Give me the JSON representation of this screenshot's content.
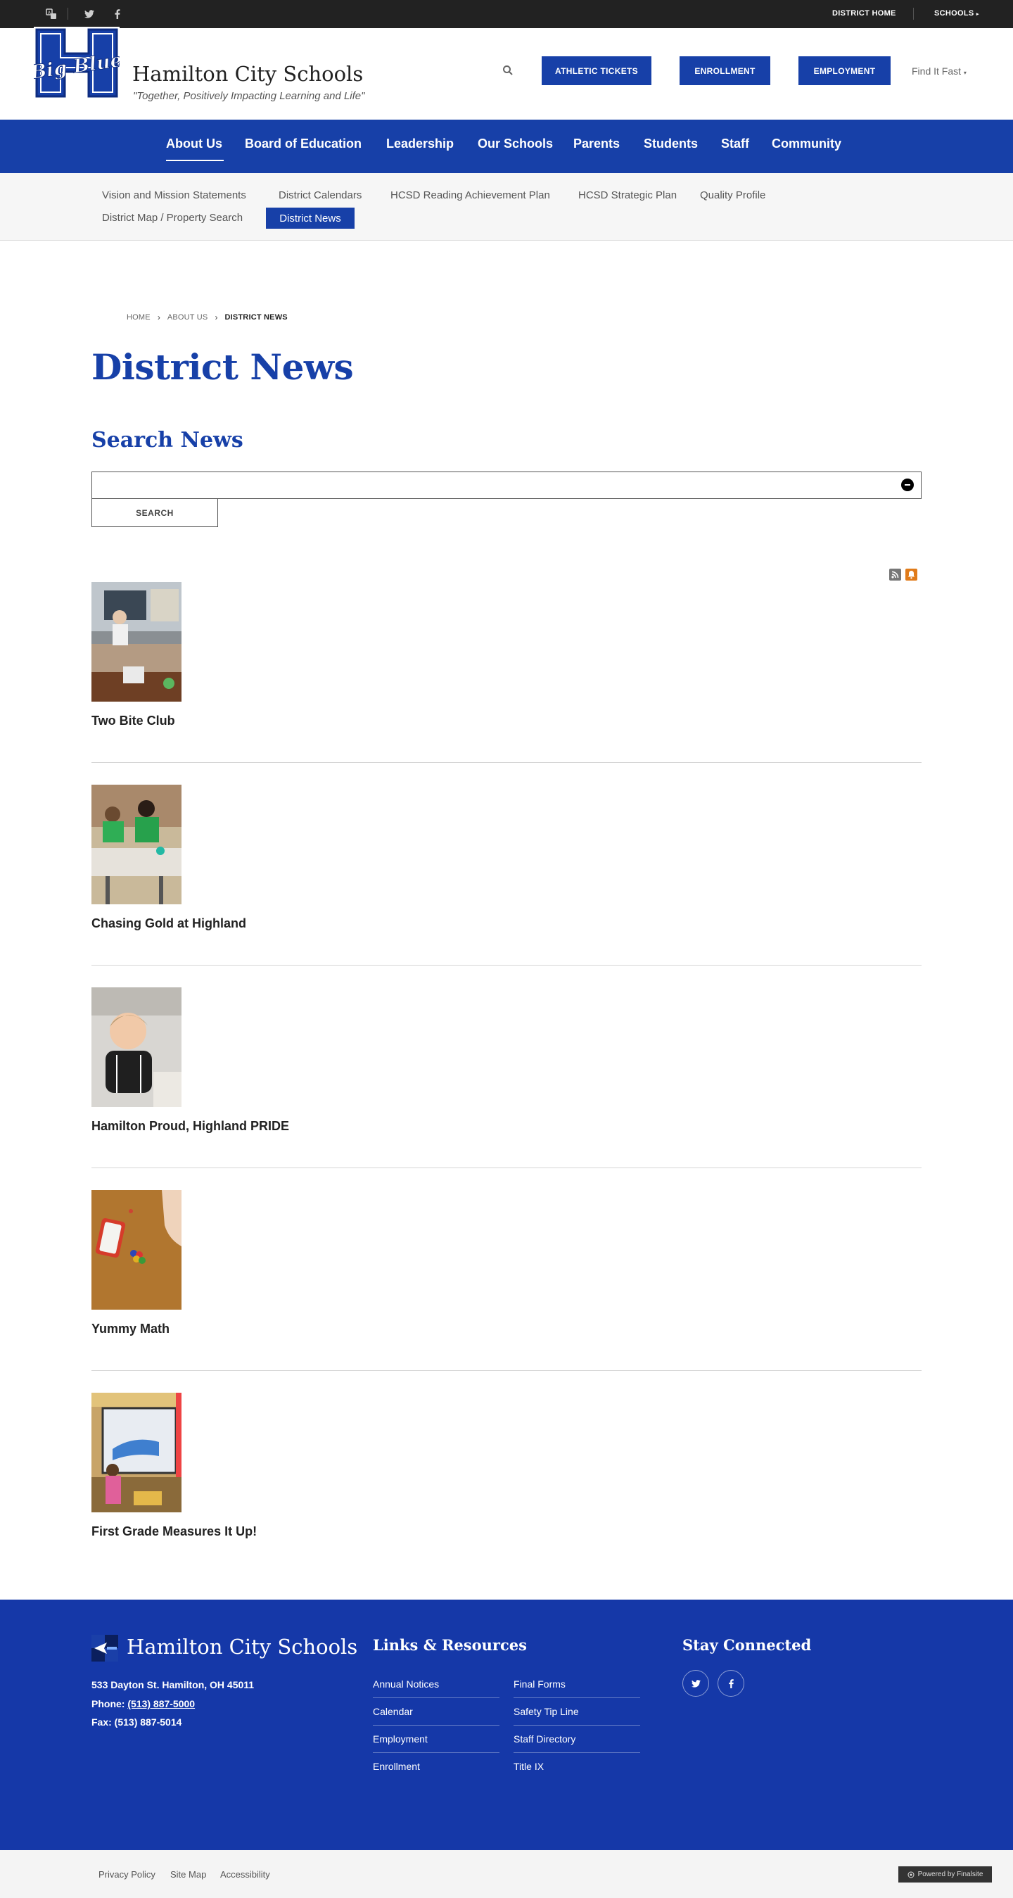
{
  "utility_bar": {
    "translate_icon": "translate-icon",
    "twitter_icon": "twitter-icon",
    "facebook_icon": "facebook-icon",
    "district_home": "DISTRICT HOME",
    "schools": "SCHOOLS"
  },
  "header": {
    "logo_text": "Big Blue",
    "site_name": "Hamilton City Schools",
    "tagline": "\"Together, Positively Impacting Learning and Life\"",
    "buttons": [
      "ATHLETIC TICKETS",
      "ENROLLMENT",
      "EMPLOYMENT"
    ],
    "find_it_fast": "Find It Fast"
  },
  "main_nav": {
    "items": [
      "About Us",
      "Board of Education",
      "Leadership",
      "Our Schools",
      "Parents",
      "Students",
      "Staff",
      "Community"
    ],
    "active": "About Us"
  },
  "sub_nav": {
    "items": [
      "Vision and Mission Statements",
      "District Calendars",
      "HCSD Reading Achievement Plan",
      "HCSD Strategic Plan",
      "Quality Profile",
      "District Map / Property Search",
      "District News"
    ],
    "active": "District News"
  },
  "breadcrumb": [
    "HOME",
    "ABOUT US",
    "DISTRICT NEWS"
  ],
  "page_title": "District News",
  "search": {
    "heading": "Search News",
    "value": "",
    "button": "SEARCH"
  },
  "feed_icons": {
    "rss": "rss-icon",
    "notify": "notification-icon"
  },
  "news": [
    {
      "title": "Two Bite Club"
    },
    {
      "title": "Chasing Gold at Highland"
    },
    {
      "title": "Hamilton Proud, Highland PRIDE"
    },
    {
      "title": "Yummy Math"
    },
    {
      "title": "First Grade Measures It Up!"
    }
  ],
  "footer": {
    "name": "Hamilton City Schools",
    "address": "533 Dayton St. Hamilton, OH  45011",
    "phone_label": "Phone:",
    "phone": "(513) 887-5000",
    "fax": "Fax: (513) 887-5014",
    "links_heading": "Links & Resources",
    "links_col1": [
      "Annual Notices",
      "Calendar",
      "Employment",
      "Enrollment"
    ],
    "links_col2": [
      "Final Forms",
      "Safety Tip Line",
      "Staff Directory",
      "Title IX"
    ],
    "connect_heading": "Stay Connected"
  },
  "bottom_bar": {
    "links": [
      "Privacy Policy",
      "Site Map",
      "Accessibility"
    ],
    "powered_by": "Powered by Finalsite"
  },
  "colors": {
    "brand_blue": "#1740a8",
    "footer_blue": "#1538a8",
    "utility_dark": "#222222"
  }
}
